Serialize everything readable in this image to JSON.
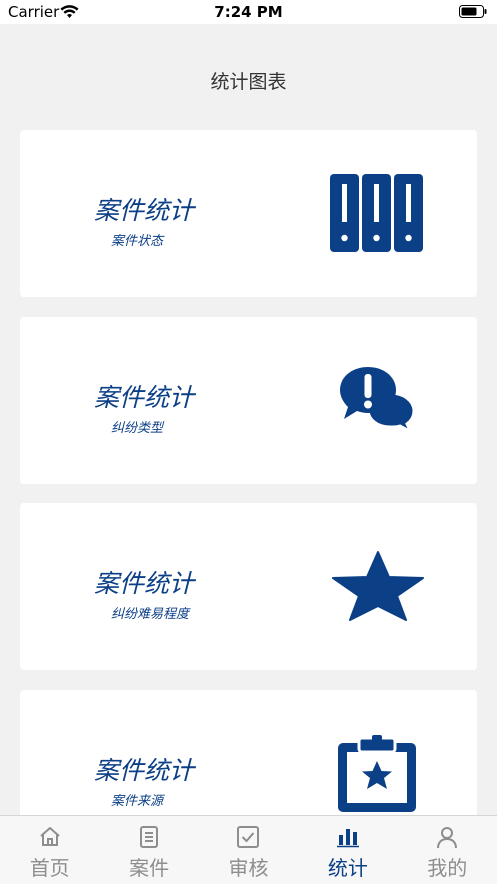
{
  "status_bar": {
    "carrier": "Carrier",
    "time": "7:24 PM"
  },
  "header": {
    "title": "统计图表"
  },
  "cards": [
    {
      "title": "案件统计",
      "subtitle": "案件状态",
      "icon": "binders-icon"
    },
    {
      "title": "案件统计",
      "subtitle": "纠纷类型",
      "icon": "chat-alert-icon"
    },
    {
      "title": "案件统计",
      "subtitle": "纠纷难易程度",
      "icon": "star-icon"
    },
    {
      "title": "案件统计",
      "subtitle": "案件来源",
      "icon": "clipboard-star-icon"
    }
  ],
  "tabs": [
    {
      "label": "首页",
      "icon": "home-icon"
    },
    {
      "label": "案件",
      "icon": "document-icon"
    },
    {
      "label": "审核",
      "icon": "check-box-icon"
    },
    {
      "label": "统计",
      "icon": "bar-chart-icon",
      "active": true
    },
    {
      "label": "我的",
      "icon": "person-icon"
    }
  ],
  "colors": {
    "accent": "#0b3f86",
    "background": "#f1f1f1",
    "inactive_tab": "#8e8e8e"
  }
}
